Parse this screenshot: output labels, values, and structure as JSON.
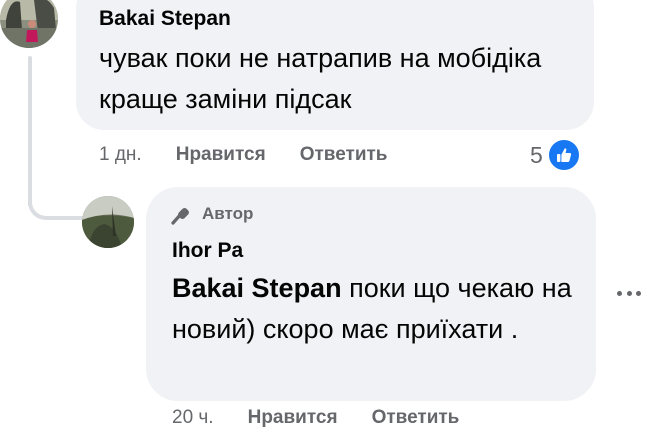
{
  "comment": {
    "author": "Bakai Stepan",
    "text": "чувак поки не натрапив на мобідіка краще заміни підсак",
    "actions": {
      "time": "1 дн.",
      "like_label": "Нравится",
      "reply_label": "Ответить"
    },
    "reactions": {
      "count": "5",
      "icon": "like-icon",
      "color": "#1877f2"
    }
  },
  "reply": {
    "badge": "Автор",
    "badge_icon": "microphone-icon",
    "author": "Ihor Pa",
    "mention": "Bakai Stepan",
    "text": " поки що чекаю на новий) скоро має приїхати .",
    "actions": {
      "time": "20 ч.",
      "like_label": "Нравится",
      "reply_label": "Ответить"
    },
    "more_icon": "more-options-icon"
  },
  "colors": {
    "bubble": "#f0f2f5",
    "meta": "#65676b",
    "text": "#050505"
  }
}
